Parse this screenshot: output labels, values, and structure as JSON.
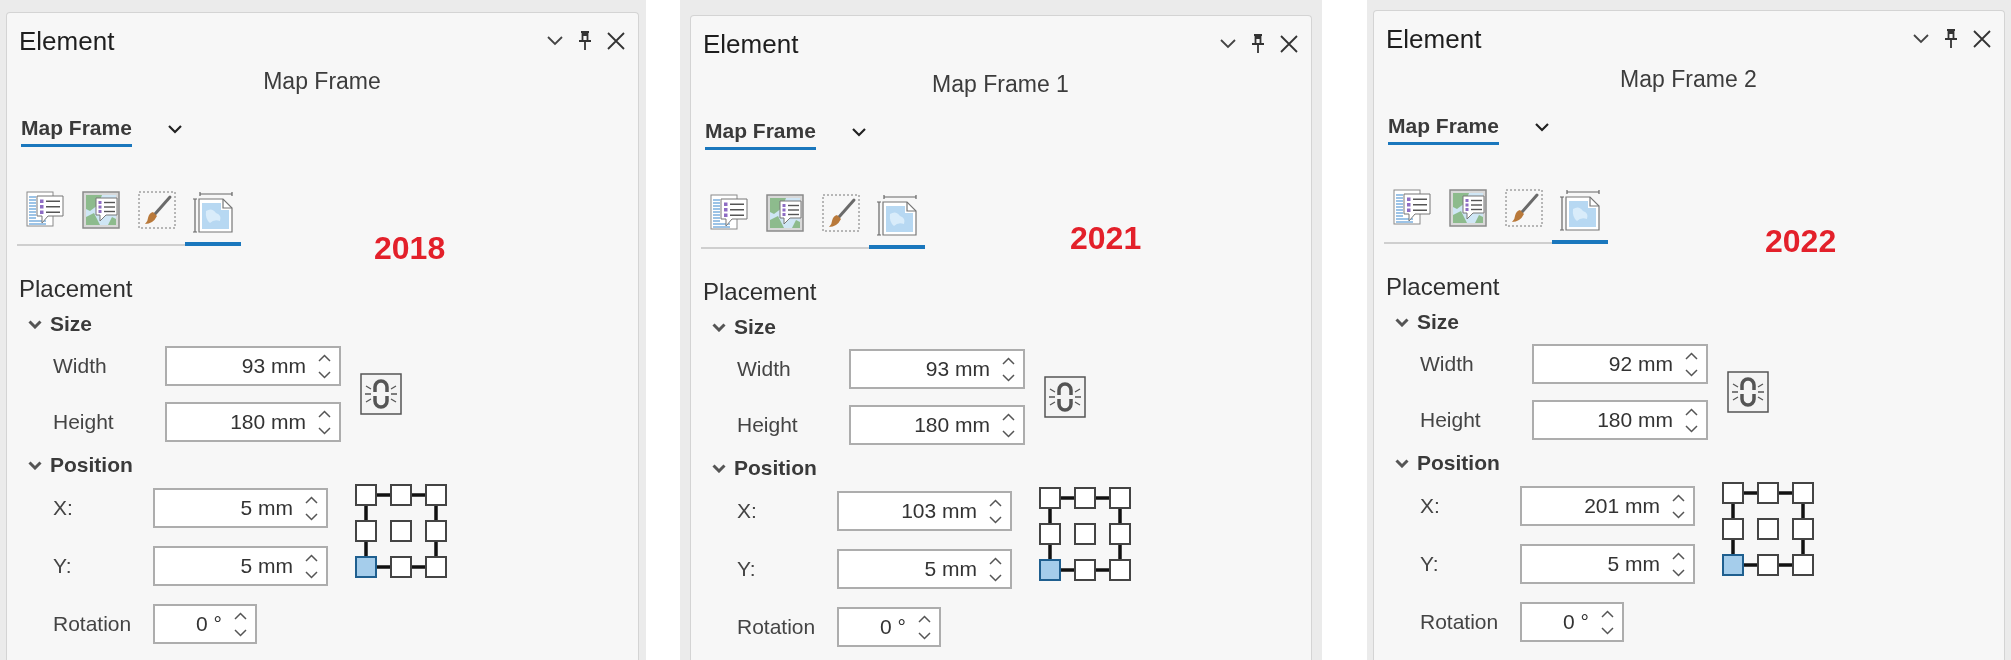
{
  "panels": [
    {
      "title": "Element",
      "subtitle": "Map Frame",
      "element_type": "Map Frame",
      "tabs": [
        {
          "kind": "list",
          "selected": false
        },
        {
          "kind": "map-list",
          "selected": false
        },
        {
          "kind": "brush",
          "selected": false
        },
        {
          "kind": "map-page",
          "selected": true
        }
      ],
      "annotation": "2018",
      "section": "Placement",
      "groups": [
        {
          "kind": "size",
          "label": "Size",
          "expanded": true,
          "fields": [
            {
              "label": "Width",
              "value": "93 mm"
            },
            {
              "label": "Height",
              "value": "180 mm"
            }
          ]
        },
        {
          "kind": "position",
          "label": "Position",
          "expanded": true,
          "fields": [
            {
              "label": "X:",
              "value": "5 mm"
            },
            {
              "label": "Y:",
              "value": "5 mm"
            }
          ],
          "anchor_points": [
            {
              "selected": false
            },
            {
              "selected": false
            },
            {
              "selected": false
            },
            {
              "selected": false
            },
            {
              "selected": false
            },
            {
              "selected": false
            },
            {
              "selected": true
            },
            {
              "selected": false
            },
            {
              "selected": false
            }
          ],
          "rotation": {
            "label": "Rotation",
            "value": "0 °"
          }
        }
      ]
    },
    {
      "title": "Element",
      "subtitle": "Map Frame 1",
      "element_type": "Map Frame",
      "tabs": [
        {
          "kind": "list",
          "selected": false
        },
        {
          "kind": "map-list",
          "selected": false
        },
        {
          "kind": "brush",
          "selected": false
        },
        {
          "kind": "map-page",
          "selected": true
        }
      ],
      "annotation": "2021",
      "section": "Placement",
      "groups": [
        {
          "kind": "size",
          "label": "Size",
          "expanded": true,
          "fields": [
            {
              "label": "Width",
              "value": "93 mm"
            },
            {
              "label": "Height",
              "value": "180 mm"
            }
          ]
        },
        {
          "kind": "position",
          "label": "Position",
          "expanded": true,
          "fields": [
            {
              "label": "X:",
              "value": "103 mm"
            },
            {
              "label": "Y:",
              "value": "5 mm"
            }
          ],
          "anchor_points": [
            {
              "selected": false
            },
            {
              "selected": false
            },
            {
              "selected": false
            },
            {
              "selected": false
            },
            {
              "selected": false
            },
            {
              "selected": false
            },
            {
              "selected": true
            },
            {
              "selected": false
            },
            {
              "selected": false
            }
          ],
          "rotation": {
            "label": "Rotation",
            "value": "0 °"
          }
        }
      ]
    },
    {
      "title": "Element",
      "subtitle": "Map Frame 2",
      "element_type": "Map Frame",
      "tabs": [
        {
          "kind": "list",
          "selected": false
        },
        {
          "kind": "map-list",
          "selected": false
        },
        {
          "kind": "brush",
          "selected": false
        },
        {
          "kind": "map-page",
          "selected": true
        }
      ],
      "annotation": "2022",
      "section": "Placement",
      "groups": [
        {
          "kind": "size",
          "label": "Size",
          "expanded": true,
          "fields": [
            {
              "label": "Width",
              "value": "92 mm"
            },
            {
              "label": "Height",
              "value": "180 mm"
            }
          ]
        },
        {
          "kind": "position",
          "label": "Position",
          "expanded": true,
          "fields": [
            {
              "label": "X:",
              "value": "201 mm"
            },
            {
              "label": "Y:",
              "value": "5 mm"
            }
          ],
          "anchor_points": [
            {
              "selected": false
            },
            {
              "selected": false
            },
            {
              "selected": false
            },
            {
              "selected": false
            },
            {
              "selected": false
            },
            {
              "selected": false
            },
            {
              "selected": true
            },
            {
              "selected": false
            },
            {
              "selected": false
            }
          ],
          "rotation": {
            "label": "Rotation",
            "value": "0 °"
          }
        }
      ]
    }
  ]
}
